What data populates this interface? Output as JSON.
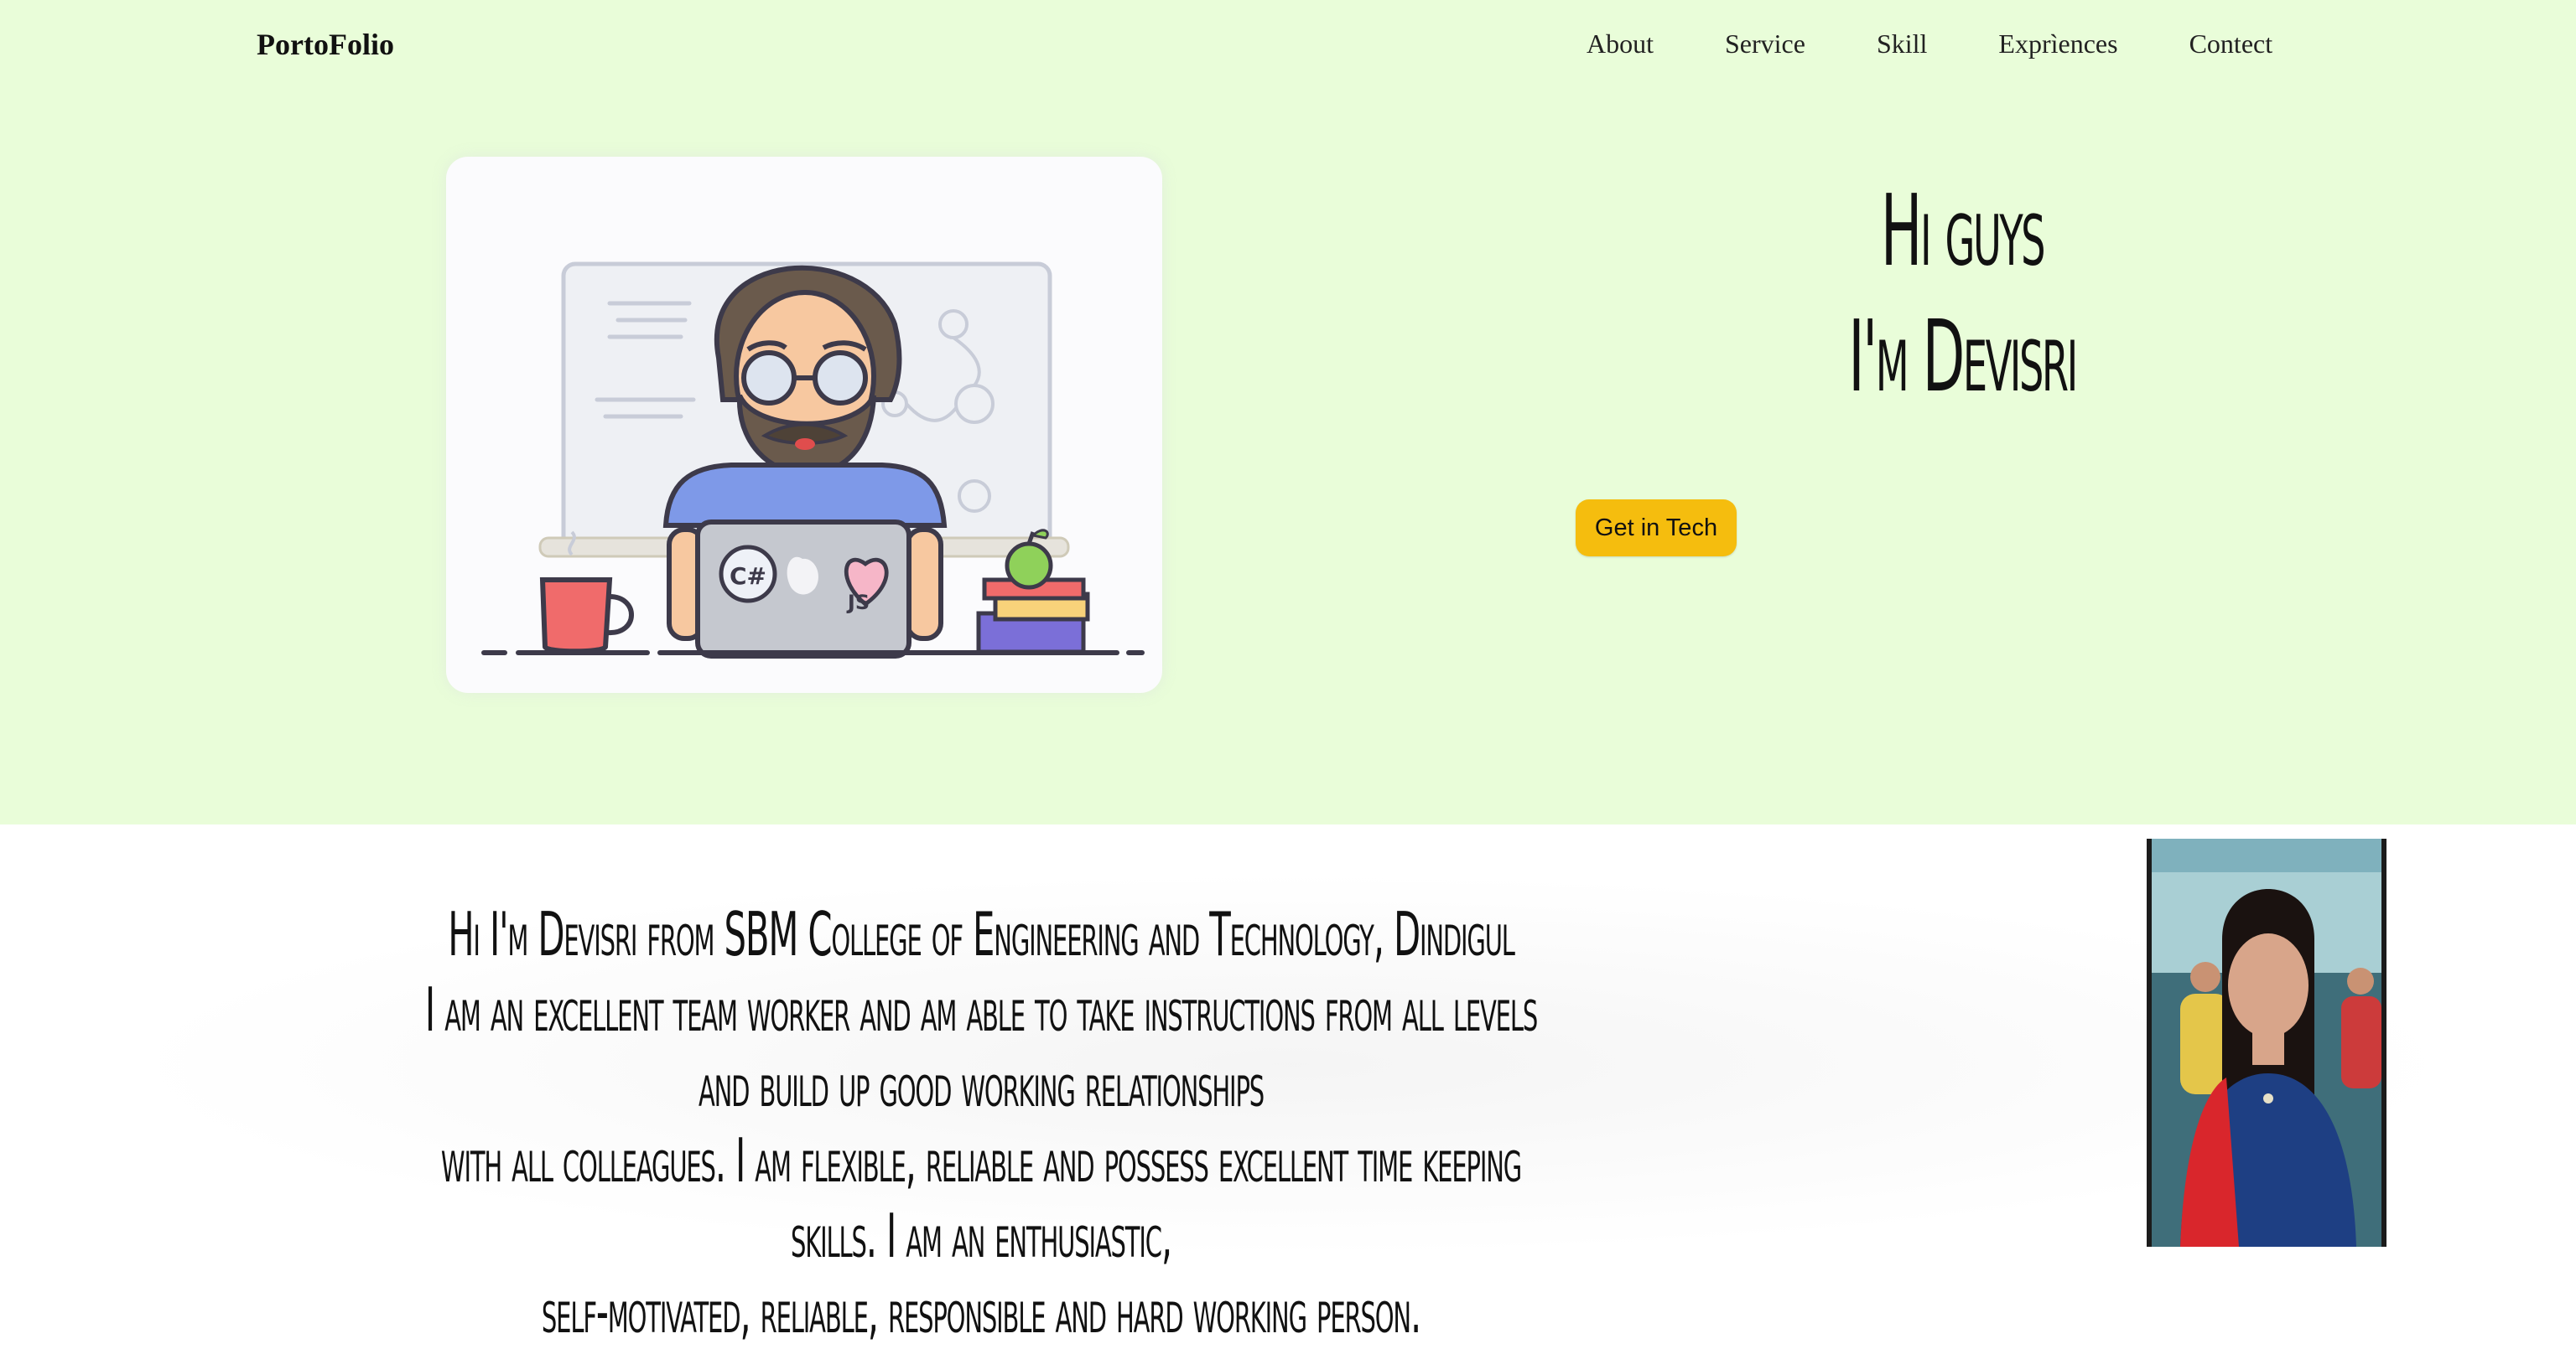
{
  "header": {
    "brand": "PortoFolio",
    "nav": [
      "About",
      "Service",
      "Skill",
      "Exprìences",
      "Contect"
    ]
  },
  "hero": {
    "line1": "Hi guys",
    "line2": "I'm Devisri",
    "cta_label": "Get in Tech",
    "illustration_labels": {
      "sticker1": "C#",
      "sticker2": "JS"
    }
  },
  "about": {
    "line1": "Hi I'm Devisri from SBM College of Engineering and Technology, Dindigul",
    "line2": "I am an excellent team worker and am able to take instructions from all levels and build up good working relationships",
    "line3": "with all colleagues. I am flexible, reliable and possess excellent time keeping skills. I am an enthusiastic,",
    "line4": "self-motivated, reliable, responsible and hard working person."
  },
  "colors": {
    "hero_bg": "#e9fdd9",
    "cta_bg": "#f5bd0e"
  }
}
